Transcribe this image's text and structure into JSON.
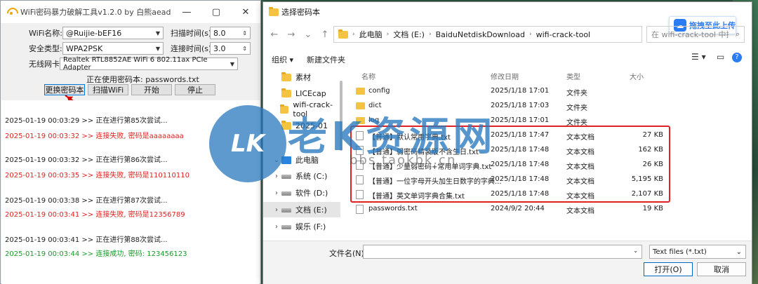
{
  "left_window": {
    "title": "WiFi密码暴力破解工具v1.2.0 by 白熊aead",
    "controls": [
      "—",
      "▢",
      "✕"
    ],
    "fields": {
      "wifi_name_label": "WiFi名称:",
      "wifi_name_value": "@Ruijie-bEF16",
      "scan_time_label": "扫描时间(s):",
      "scan_time_value": "8.0",
      "security_label": "安全类型:",
      "security_value": "WPA2PSK",
      "connect_time_label": "连接时间(s):",
      "connect_time_value": "3.0",
      "adapter_label": "无线网卡:",
      "adapter_value": "Realtek RTL8852AE WiFi 6 802.11ax PCIe Adapter",
      "dict_status": "正在使用密码本: passwords.txt"
    },
    "buttons": {
      "change_dict": "更换密码本",
      "scan_wifi": "扫描WiFi",
      "start": "开始",
      "stop": "停止"
    },
    "log": [
      {
        "text": "2025-01-19 00:03:29 >> 正在进行第85次尝试...",
        "kind": "info"
      },
      {
        "text": "2025-01-19 00:03:32 >> 连接失败, 密码是aaaaaaaa",
        "kind": "fail"
      },
      {
        "text": "2025-01-19 00:03:32 >> 正在进行第86次尝试...",
        "kind": "info"
      },
      {
        "text": "2025-01-19 00:03:35 >> 连接失败, 密码是110110110",
        "kind": "fail"
      },
      {
        "text": "2025-01-19 00:03:38 >> 正在进行第87次尝试...",
        "kind": "info"
      },
      {
        "text": "2025-01-19 00:03:41 >> 连接失败, 密码是12356789",
        "kind": "fail"
      },
      {
        "text": "2025-01-19 00:03:41 >> 正在进行第88次尝试...",
        "kind": "info"
      },
      {
        "text": "2025-01-19 00:03:44 >> 连接成功, 密码: 123456123",
        "kind": "ok"
      }
    ]
  },
  "dialog": {
    "title": "选择密码本",
    "upload_label": "拖拽至此上传",
    "nav": {
      "back": "←",
      "forward": "→",
      "down": "⌄",
      "up": "↑"
    },
    "address": [
      "此电脑",
      "文档 (E:)",
      "BaiduNetdiskDownload",
      "wifi-crack-tool"
    ],
    "search_placeholder": "在 wifi-crack-tool 中搜索",
    "toolbar": {
      "organize": "组织 ▾",
      "new_folder": "新建文件夹"
    },
    "tree": [
      {
        "label": "素材",
        "kind": "folder"
      },
      {
        "label": "LICEcap",
        "kind": "folder"
      },
      {
        "label": "wifi-crack-tool",
        "kind": "folder"
      },
      {
        "label": "2025-01",
        "kind": "folder"
      },
      {
        "label": "此电脑",
        "kind": "pc"
      },
      {
        "label": "系统 (C:)",
        "kind": "drive"
      },
      {
        "label": "软件 (D:)",
        "kind": "drive"
      },
      {
        "label": "文档 (E:)",
        "kind": "drive"
      },
      {
        "label": "娱乐 (F:)",
        "kind": "drive"
      }
    ],
    "columns": {
      "name": "名称",
      "modified": "修改日期",
      "type": "类型",
      "size": "大小"
    },
    "files": [
      {
        "name": "config",
        "modified": "2025/1/18 17:01",
        "type": "文件夹",
        "size": "",
        "folder": true
      },
      {
        "name": "dict",
        "modified": "2025/1/18 17:03",
        "type": "文件夹",
        "size": "",
        "folder": true
      },
      {
        "name": "log",
        "modified": "2025/1/18 17:01",
        "type": "文件夹",
        "size": "",
        "folder": true
      },
      {
        "name": "【普通】默认常用字典.txt",
        "modified": "2025/1/18 17:47",
        "type": "文本文档",
        "size": "27 KB",
        "folder": false
      },
      {
        "name": "【普通】弱密码精装版不含生日.txt",
        "modified": "2025/1/18 17:48",
        "type": "文本文档",
        "size": "162 KB",
        "folder": false
      },
      {
        "name": "【普通】少量弱密码+常用单词字典.txt",
        "modified": "2025/1/18 17:48",
        "type": "文本文档",
        "size": "26 KB",
        "folder": false
      },
      {
        "name": "【普通】一位字母开头加生日数字的字典...",
        "modified": "2025/1/18 17:48",
        "type": "文本文档",
        "size": "5,195 KB",
        "folder": false
      },
      {
        "name": "【普通】英文单词字典合集.txt",
        "modified": "2025/1/18 17:48",
        "type": "文本文档",
        "size": "2,107 KB",
        "folder": false
      },
      {
        "name": "passwords.txt",
        "modified": "2024/9/2 20:44",
        "type": "文本文档",
        "size": "19 KB",
        "folder": false
      }
    ],
    "filename_label": "文件名(N):",
    "filename_value": "",
    "filter": "Text files (*.txt)",
    "open_label": "打开(O)",
    "cancel_label": "取消"
  },
  "watermark": {
    "logo": "LK",
    "text": "老K资源网",
    "url": "bbs.taokbk.cn"
  },
  "colors": {
    "fail": "#e02020",
    "ok": "#1a9a2a",
    "highlight": "#e02222",
    "accent": "#2a7cf4"
  }
}
